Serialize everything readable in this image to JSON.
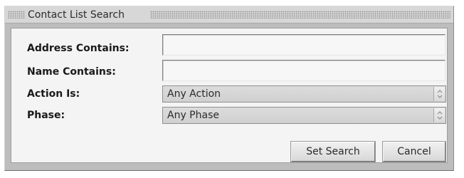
{
  "dialog": {
    "title": "Contact List Search"
  },
  "fields": {
    "address_label": "Address Contains:",
    "address_value": "",
    "name_label": "Name Contains:",
    "name_value": "",
    "action_label": "Action Is:",
    "action_selected": "Any Action",
    "phase_label": "Phase:",
    "phase_selected": "Any Phase"
  },
  "buttons": {
    "set_search": "Set Search",
    "cancel": "Cancel"
  },
  "icons": {
    "select_arrow": "up-down-chevron-icon",
    "title_grip": "grip-dots-icon"
  },
  "colors": {
    "frame": "#bdbdbd",
    "titlebar": "#d7d7d7",
    "body": "#f4f4f4",
    "select_bg": "#d4d4d4"
  }
}
